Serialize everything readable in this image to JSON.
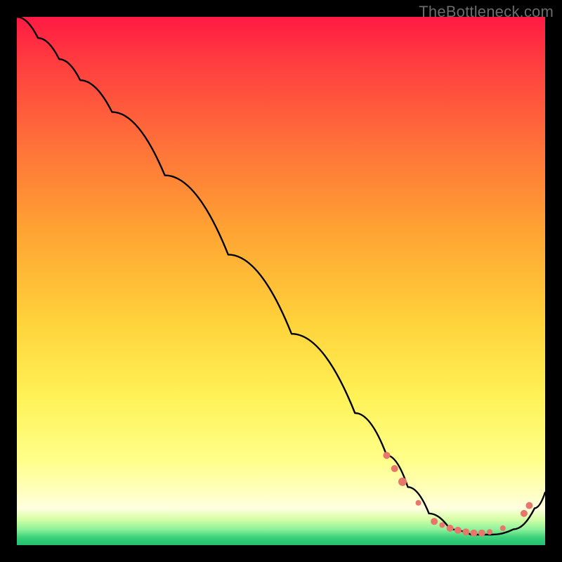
{
  "watermark": "TheBottleneck.com",
  "colors": {
    "curve_stroke": "#000000",
    "marker_fill": "#e8766b",
    "marker_stroke": "#cf5d55"
  },
  "chart_data": {
    "type": "line",
    "title": "",
    "xlabel": "",
    "ylabel": "",
    "xlim": [
      0,
      100
    ],
    "ylim": [
      0,
      100
    ],
    "series": [
      {
        "name": "curve",
        "x": [
          0,
          4,
          8,
          12,
          18,
          28,
          40,
          52,
          64,
          70,
          74,
          78,
          82,
          86,
          90,
          94,
          98,
          100
        ],
        "y": [
          100,
          96,
          92,
          88,
          82,
          70,
          55,
          40,
          25,
          17,
          11,
          6,
          3,
          2,
          2,
          3,
          7,
          10
        ]
      }
    ],
    "markers": [
      {
        "x": 70,
        "y": 17,
        "r": 5
      },
      {
        "x": 71.5,
        "y": 14.5,
        "r": 5
      },
      {
        "x": 73,
        "y": 12,
        "r": 6
      },
      {
        "x": 76,
        "y": 8,
        "r": 4
      },
      {
        "x": 79,
        "y": 4.5,
        "r": 5
      },
      {
        "x": 80.5,
        "y": 3.8,
        "r": 4
      },
      {
        "x": 82,
        "y": 3.2,
        "r": 5
      },
      {
        "x": 83.5,
        "y": 2.8,
        "r": 5
      },
      {
        "x": 85,
        "y": 2.5,
        "r": 5
      },
      {
        "x": 86.5,
        "y": 2.3,
        "r": 5
      },
      {
        "x": 88,
        "y": 2.3,
        "r": 5
      },
      {
        "x": 89.5,
        "y": 2.5,
        "r": 4
      },
      {
        "x": 92,
        "y": 3.2,
        "r": 4
      },
      {
        "x": 96,
        "y": 6,
        "r": 5
      },
      {
        "x": 97,
        "y": 7.5,
        "r": 5
      }
    ]
  }
}
